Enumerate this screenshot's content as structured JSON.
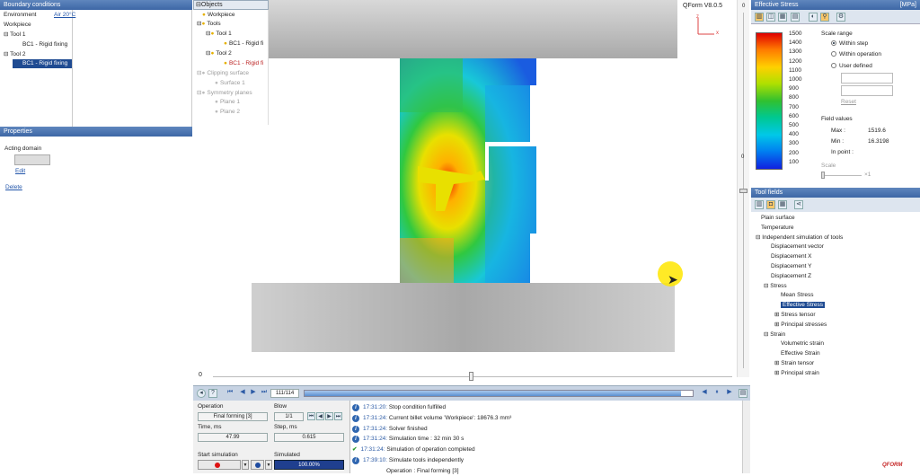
{
  "left": {
    "bc_title": "Boundary conditions",
    "bc_rows": [
      {
        "label": "Environment",
        "value": "Air 20°C"
      },
      {
        "label": "Workpiece",
        "value": ""
      },
      {
        "label": "Tool 1",
        "value": ""
      },
      {
        "label": "BC1 - Rigid fixing",
        "value": ""
      },
      {
        "label": "Tool 2",
        "value": ""
      },
      {
        "label": "BC1 - Rigid fixing",
        "value": ""
      }
    ],
    "props_title": "Properties",
    "acting_domain": "Acting domain",
    "edit": "Edit",
    "delete": "Delete"
  },
  "objects": {
    "title": "Objects",
    "items": [
      "Workpiece",
      "Tools",
      "Tool 1",
      "BC1 - Rigid fi",
      "Tool 2",
      "BC1 - Rigid fi",
      "Clipping surface",
      "Surface 1",
      "Symmetry planes",
      "Plane 1",
      "Plane 2"
    ]
  },
  "viewport": {
    "version": "QForm V8.0.5",
    "axis_z": "z",
    "axis_x": "x"
  },
  "timeline": {
    "start": "0",
    "frame": "111/114"
  },
  "ops": {
    "operation_label": "Operation",
    "operation_value": "Final forming [3]",
    "blow_label": "Blow",
    "blow_value": "1/1",
    "time_label": "Time, ms",
    "time_value": "47.99",
    "step_label": "Step, ms",
    "step_value": "0.615",
    "start_label": "Start simulation",
    "simulated_label": "Simulated",
    "simulated_value": "100.00%",
    "progress": 1.0
  },
  "log": [
    {
      "time": "17:31:20:",
      "msg": "Stop condition fulfilled",
      "type": "info"
    },
    {
      "time": "17:31:24:",
      "msg": "Current billet volume 'Workpiece': 18676.3 mm³",
      "type": "info"
    },
    {
      "time": "17:31:24:",
      "msg": "Solver finished",
      "type": "info"
    },
    {
      "time": "17:31:24:",
      "msg": "Simulation time : 32 min 30 s",
      "type": "info"
    },
    {
      "time": "17:31:24:",
      "msg": "Simulation of operation completed",
      "type": "ok"
    },
    {
      "time": "17:39:10:",
      "msg": "Simulate tools independently",
      "type": "info"
    },
    {
      "time": "",
      "msg": "Operation : Final forming [3]",
      "type": "none"
    }
  ],
  "right": {
    "title": "Effective Stress",
    "unit": "[MPa]",
    "scale_values": [
      "1500",
      "1400",
      "1300",
      "1200",
      "1100",
      "1000",
      "900",
      "800",
      "700",
      "600",
      "500",
      "400",
      "300",
      "200",
      "100"
    ],
    "scale_range": "Scale range",
    "options": [
      "Within step",
      "Within operation",
      "User defined"
    ],
    "reset": "Reset",
    "field_values": "Field values",
    "max_label": "Max :",
    "max_value": "1519.6",
    "min_label": "Min :",
    "min_value": "16.3198",
    "inpoint_label": "In point :",
    "scale_label": "Scale",
    "scale_x": "×1",
    "tool_fields_title": "Tool fields",
    "tree": [
      "Plain surface",
      "Temperature",
      "Independent simulation of tools",
      "Displacement vector",
      "Displacement X",
      "Displacement Y",
      "Displacement Z",
      "Stress",
      "Mean Stress",
      "Effective Stress",
      "Stress tensor",
      "Principal stresses",
      "Strain",
      "Volumetric strain",
      "Effective Strain",
      "Strain tensor",
      "Principal strain"
    ]
  },
  "vslider": {
    "top": "0",
    "mid": "0"
  },
  "logo": "QFORM"
}
